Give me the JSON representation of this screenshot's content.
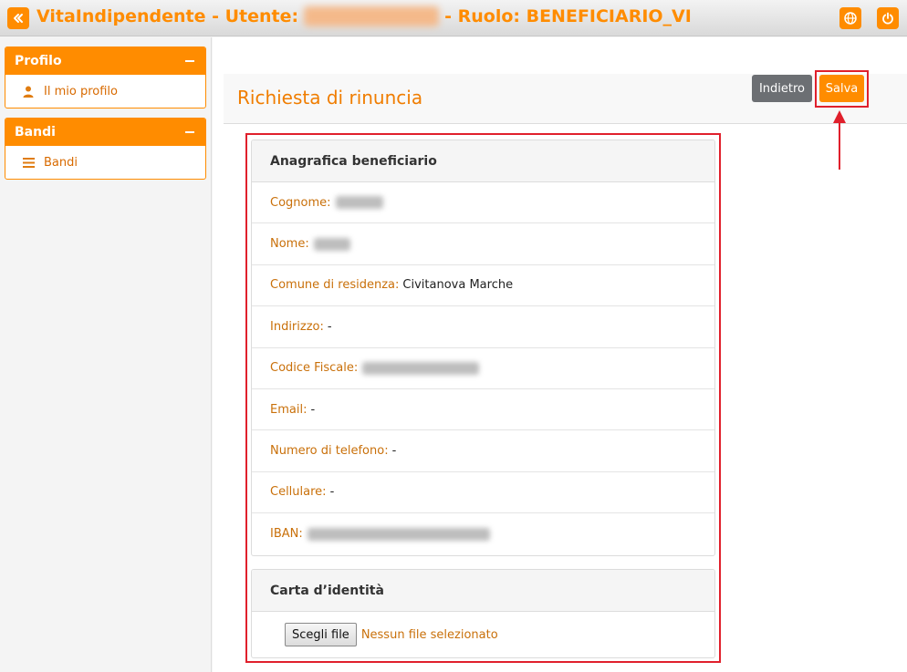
{
  "header": {
    "title_app": "VitaIndipendente - Utente:",
    "title_role": "- Ruolo: BENEFICIARIO_VI",
    "user_name": "Pasquale Olaca"
  },
  "sidebar": {
    "panels": [
      {
        "title": "Profilo",
        "items": [
          {
            "label": "Il mio profilo",
            "icon": "user-icon"
          }
        ]
      },
      {
        "title": "Bandi",
        "items": [
          {
            "label": "Bandi",
            "icon": "list-icon"
          }
        ]
      }
    ]
  },
  "page": {
    "title": "Richiesta di rinuncia",
    "back_label": "Indietro",
    "save_label": "Salva"
  },
  "beneficiary": {
    "title": "Anagrafica beneficiario",
    "fields": [
      {
        "label": "Cognome:",
        "value": "Pasquale"
      },
      {
        "label": "Nome:",
        "value": "Olaca"
      },
      {
        "label": "Comune di residenza:",
        "value": "Civitanova Marche"
      },
      {
        "label": "Indirizzo:",
        "value": "-"
      },
      {
        "label": "Codice Fiscale:",
        "value": "PSQLCA00A00A000A"
      },
      {
        "label": "Email:",
        "value": "-"
      },
      {
        "label": "Numero di telefono:",
        "value": "-"
      },
      {
        "label": "Cellulare:",
        "value": "-"
      },
      {
        "label": "IBAN:",
        "value": "IT00X0000000000000000000000"
      }
    ]
  },
  "identity": {
    "title": "Carta d’identità",
    "file_button": "Scegli file",
    "file_status": "Nessun file selezionato"
  },
  "colors": {
    "accent": "#ff8c00",
    "highlight": "#e0202c",
    "secondary": "#6c6f73"
  }
}
